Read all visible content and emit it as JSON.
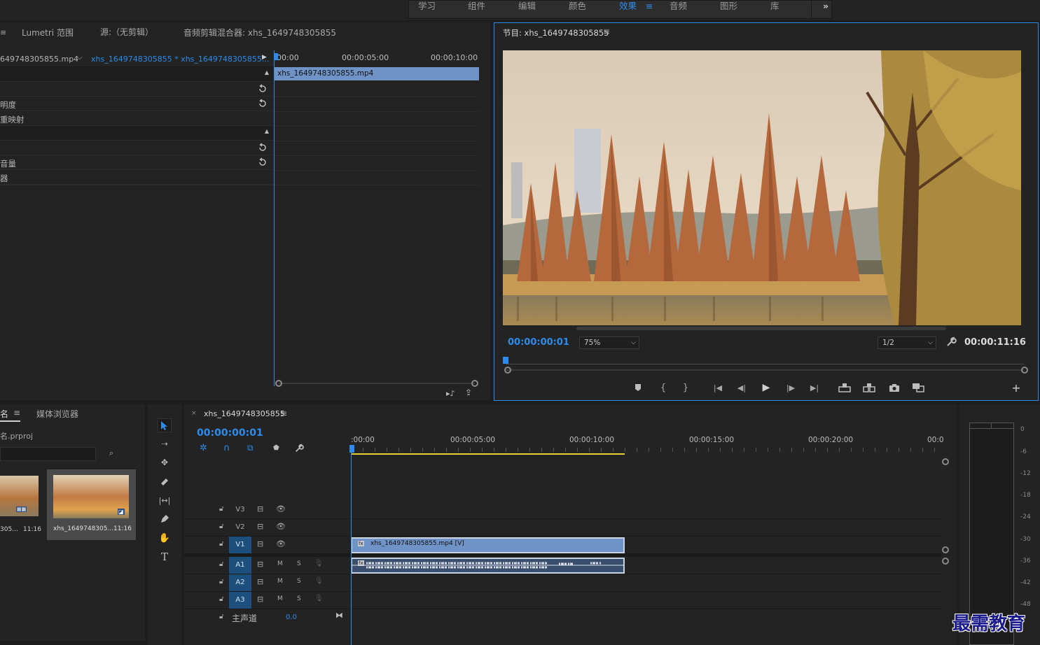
{
  "workspaces": [
    "学习",
    "组件",
    "编辑",
    "颜色",
    "效果",
    "音频",
    "图形",
    "库"
  ],
  "workspace_active": "效果",
  "workspace_more": "»",
  "upper_tabs": {
    "lumetri": "Lumetri 范围",
    "source": "源:（无剪辑）",
    "mixer": "音频剪辑混合器: xhs_1649748305855"
  },
  "effect_controls": {
    "clip_name": "649748305855.mp4",
    "sequence_clip": "xhs_1649748305855 * xhs_1649748305855...",
    "ruler": [
      "00:00",
      "00:00:05:00",
      "00:00:10:00"
    ],
    "clip_bar": "xhs_1649748305855.mp4",
    "rows": [
      "明度",
      "重映射",
      "音量",
      "器"
    ]
  },
  "program": {
    "title": "节目: xhs_1649748305855",
    "timecode_current": "00:00:00:01",
    "zoom": "75%",
    "resolution": "1/2",
    "timecode_duration": "00:00:11:16"
  },
  "project": {
    "tab_name": "名",
    "tab_media": "媒体浏览器",
    "file": "名.prproj",
    "items": [
      {
        "name": "305...",
        "duration": "11:16"
      },
      {
        "name": "xhs_1649748305...",
        "duration": "11:16"
      }
    ]
  },
  "timeline": {
    "sequence": "xhs_1649748305855",
    "timecode": "00:00:00:01",
    "ruler": [
      ":00:00",
      "00:00:05:00",
      "00:00:10:00",
      "00:00:15:00",
      "00:00:20:00",
      "00:0"
    ],
    "video_tracks": [
      "V3",
      "V2",
      "V1"
    ],
    "audio_tracks": [
      "A1",
      "A2",
      "A3"
    ],
    "mute": "M",
    "solo": "S",
    "master": "主声道",
    "master_value": "0.0",
    "video_clip": "xhs_1649748305855.mp4 [V]"
  },
  "meters": {
    "scale": [
      "0",
      "-6",
      "-12",
      "-18",
      "-24",
      "-30",
      "-36",
      "-42",
      "-48"
    ]
  },
  "watermark": "最需教育",
  "colors": {
    "accent": "#2d8ceb",
    "video_clip": "#6f93c6",
    "audio_clip": "#3a4f6e",
    "work_area": "#e6d337"
  }
}
